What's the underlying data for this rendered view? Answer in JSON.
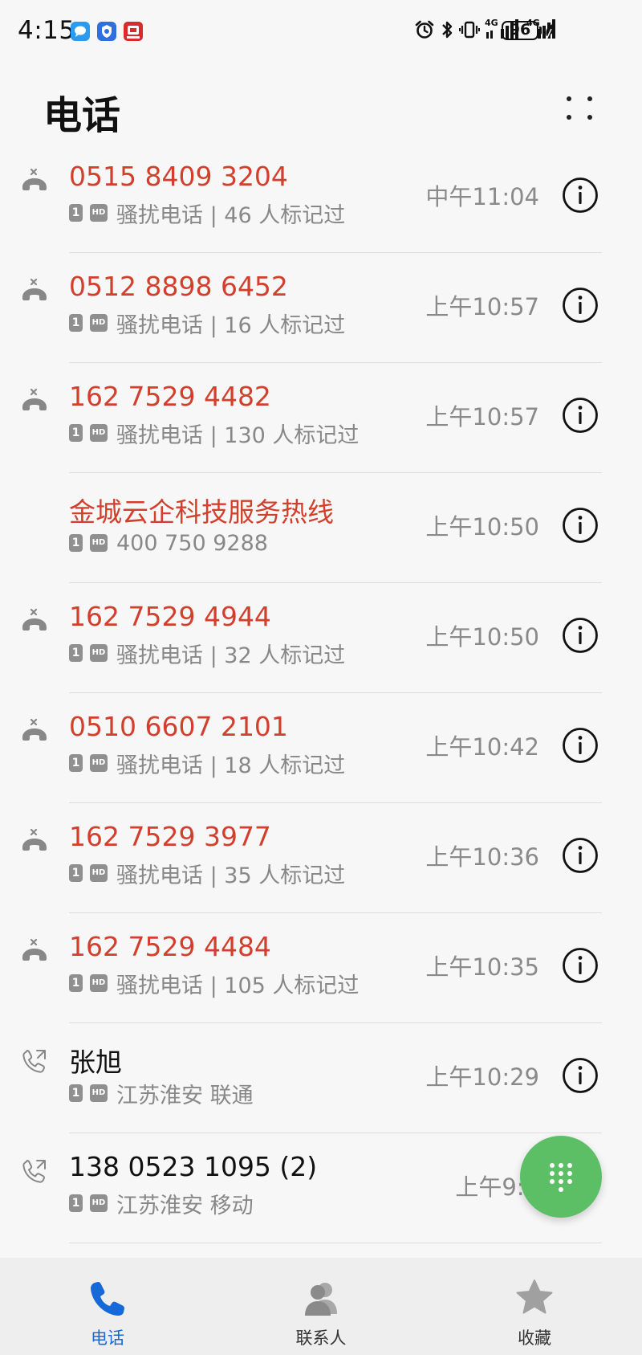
{
  "status_bar": {
    "time": "4:15",
    "network_1": "4G",
    "network_2": "4G",
    "battery": "96"
  },
  "header": {
    "title": "电话"
  },
  "colors": {
    "spam_red": "#d2402d",
    "accent_blue": "#1769d8",
    "fab_green": "#5cbf66"
  },
  "calls": [
    {
      "name": "0515 8409 3204",
      "sim": "1",
      "hd": "HD",
      "subtext": "骚扰电话 | 46 人标记过",
      "time": "中午11:04",
      "type": "spam"
    },
    {
      "name": "0512 8898 6452",
      "sim": "1",
      "hd": "HD",
      "subtext": "骚扰电话 | 16 人标记过",
      "time": "上午10:57",
      "type": "spam"
    },
    {
      "name": "162 7529 4482",
      "sim": "1",
      "hd": "HD",
      "subtext": "骚扰电话 | 130 人标记过",
      "time": "上午10:57",
      "type": "spam"
    },
    {
      "name": "金城云企科技服务热线",
      "sim": "1",
      "hd": "HD",
      "subtext": "400 750 9288",
      "time": "上午10:50",
      "type": "missed-named"
    },
    {
      "name": "162 7529 4944",
      "sim": "1",
      "hd": "HD",
      "subtext": "骚扰电话 | 32 人标记过",
      "time": "上午10:50",
      "type": "spam"
    },
    {
      "name": "0510 6607 2101",
      "sim": "1",
      "hd": "HD",
      "subtext": "骚扰电话 | 18 人标记过",
      "time": "上午10:42",
      "type": "spam"
    },
    {
      "name": "162 7529 3977",
      "sim": "1",
      "hd": "HD",
      "subtext": "骚扰电话 | 35 人标记过",
      "time": "上午10:36",
      "type": "spam"
    },
    {
      "name": "162 7529 4484",
      "sim": "1",
      "hd": "HD",
      "subtext": "骚扰电话 | 105 人标记过",
      "time": "上午10:35",
      "type": "spam"
    },
    {
      "name": "张旭",
      "sim": "1",
      "hd": "HD",
      "subtext": "江苏淮安 联通",
      "time": "上午10:29",
      "type": "outgoing"
    },
    {
      "name": "138 0523 1095 (2)",
      "sim": "1",
      "hd": "HD",
      "subtext": "江苏淮安 移动",
      "time": "上午9:4",
      "type": "outgoing"
    }
  ],
  "bottom_nav": {
    "phone": "电话",
    "contacts": "联系人",
    "favorites": "收藏"
  }
}
